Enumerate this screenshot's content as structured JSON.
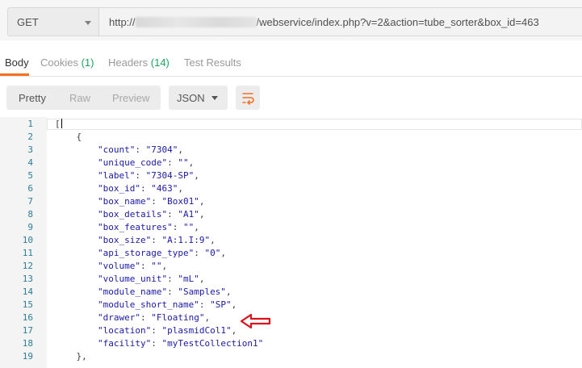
{
  "request": {
    "method": "GET",
    "url_prefix": "http://",
    "url_path": "/webservice/index.php?v=2&action=tube_sorter&box_id=463"
  },
  "response_tabs": [
    {
      "label": "Body",
      "count": ""
    },
    {
      "label": "Cookies",
      "count": "(1)"
    },
    {
      "label": "Headers",
      "count": "(14)"
    },
    {
      "label": "Test Results",
      "count": ""
    }
  ],
  "toolbar": {
    "view_modes": [
      "Pretty",
      "Raw",
      "Preview"
    ],
    "format": "JSON",
    "wrap_icon": "wrap-lines-icon"
  },
  "code_lines": [
    {
      "num": "1",
      "indent": "",
      "key": "",
      "value": "",
      "text": "["
    },
    {
      "num": "2",
      "indent": "    ",
      "key": "",
      "value": "",
      "text": "{"
    },
    {
      "num": "3",
      "indent": "        ",
      "key": "\"count\"",
      "value": "\"7304\"",
      "text": ","
    },
    {
      "num": "4",
      "indent": "        ",
      "key": "\"unique_code\"",
      "value": "\"\"",
      "text": ","
    },
    {
      "num": "5",
      "indent": "        ",
      "key": "\"label\"",
      "value": "\"7304-SP\"",
      "text": ","
    },
    {
      "num": "6",
      "indent": "        ",
      "key": "\"box_id\"",
      "value": "\"463\"",
      "text": ","
    },
    {
      "num": "7",
      "indent": "        ",
      "key": "\"box_name\"",
      "value": "\"Box01\"",
      "text": ","
    },
    {
      "num": "8",
      "indent": "        ",
      "key": "\"box_details\"",
      "value": "\"A1\"",
      "text": ","
    },
    {
      "num": "9",
      "indent": "        ",
      "key": "\"box_features\"",
      "value": "\"\"",
      "text": ","
    },
    {
      "num": "10",
      "indent": "        ",
      "key": "\"box_size\"",
      "value": "\"A:1.I:9\"",
      "text": ","
    },
    {
      "num": "11",
      "indent": "        ",
      "key": "\"api_storage_type\"",
      "value": "\"0\"",
      "text": ","
    },
    {
      "num": "12",
      "indent": "        ",
      "key": "\"volume\"",
      "value": "\"\"",
      "text": ","
    },
    {
      "num": "13",
      "indent": "        ",
      "key": "\"volume_unit\"",
      "value": "\"mL\"",
      "text": ","
    },
    {
      "num": "14",
      "indent": "        ",
      "key": "\"module_name\"",
      "value": "\"Samples\"",
      "text": ","
    },
    {
      "num": "15",
      "indent": "        ",
      "key": "\"module_short_name\"",
      "value": "\"SP\"",
      "text": ","
    },
    {
      "num": "16",
      "indent": "        ",
      "key": "\"drawer\"",
      "value": "\"Floating\"",
      "text": ","
    },
    {
      "num": "17",
      "indent": "        ",
      "key": "\"location\"",
      "value": "\"plasmidCol1\"",
      "text": ","
    },
    {
      "num": "18",
      "indent": "        ",
      "key": "\"facility\"",
      "value": "\"myTestCollection1\"",
      "text": ""
    },
    {
      "num": "19",
      "indent": "    ",
      "key": "",
      "value": "",
      "text": "},"
    }
  ],
  "colors": {
    "accent_orange": "#f47023",
    "count_green": "#1aa760",
    "json_string": "#1a1aa6",
    "arrow_red": "#e0101a"
  }
}
